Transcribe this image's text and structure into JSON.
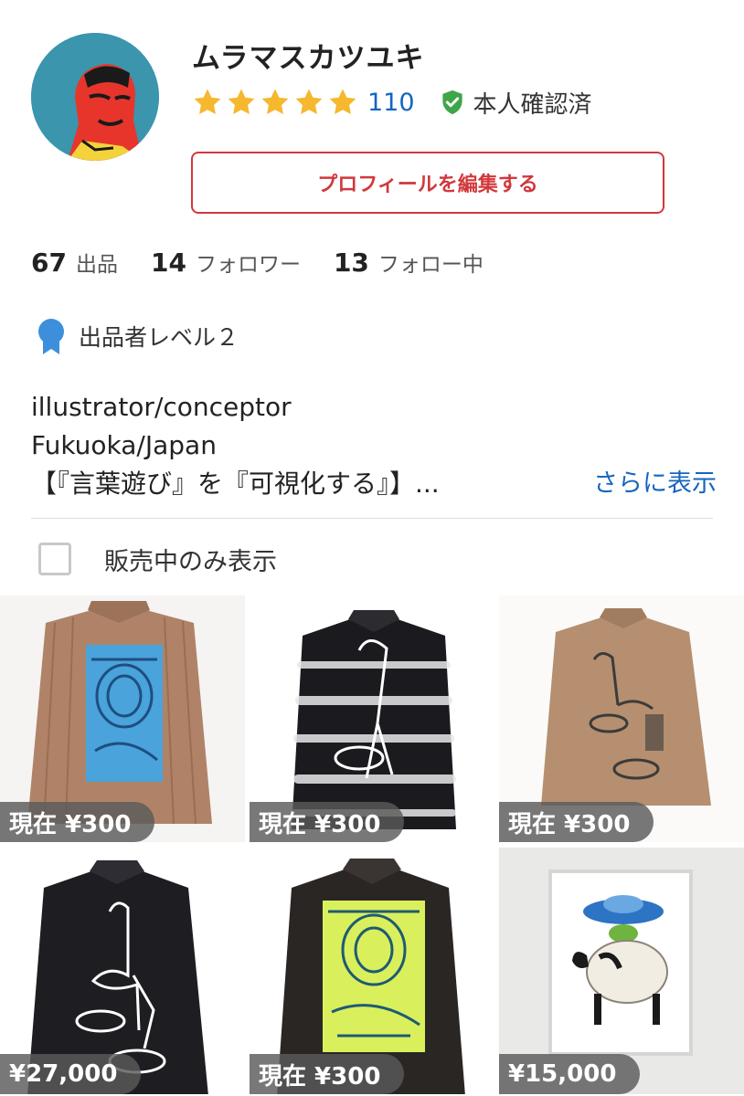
{
  "profile": {
    "username": "ムラマスカツユキ",
    "rating_stars": 5,
    "review_count": "110",
    "verified_label": "本人確認済",
    "edit_button_label": "プロフィールを編集する"
  },
  "stats": [
    {
      "value": "67",
      "label": "出品"
    },
    {
      "value": "14",
      "label": "フォロワー"
    },
    {
      "value": "13",
      "label": "フォロー中"
    }
  ],
  "seller_level": {
    "label": "出品者レベル２"
  },
  "bio": {
    "lines": [
      "illustrator/conceptor",
      "Fukuoka/Japan",
      "【『言葉遊び』を『可視化する』】..."
    ],
    "more_link": "さらに表示"
  },
  "filter": {
    "label": "販売中のみ表示",
    "checked": false
  },
  "items": [
    {
      "price": "現在 ¥300",
      "subject": "brown striped shirt with blue print"
    },
    {
      "price": "現在 ¥300",
      "subject": "black tie-dye shirt with bird print"
    },
    {
      "price": "現在 ¥300",
      "subject": "tan shirt with ink drawing"
    },
    {
      "price": "¥27,000",
      "subject": "black shirt with white ostrich print"
    },
    {
      "price": "現在 ¥300",
      "subject": "black jacket with yellow print"
    },
    {
      "price": "¥15,000",
      "subject": "framed cow ufo artwork"
    }
  ],
  "colors": {
    "accent": "#d1383c",
    "link": "#1565c0",
    "star": "#f5b82e",
    "verified": "#3fa54a",
    "badge": "#3d8fdc"
  }
}
